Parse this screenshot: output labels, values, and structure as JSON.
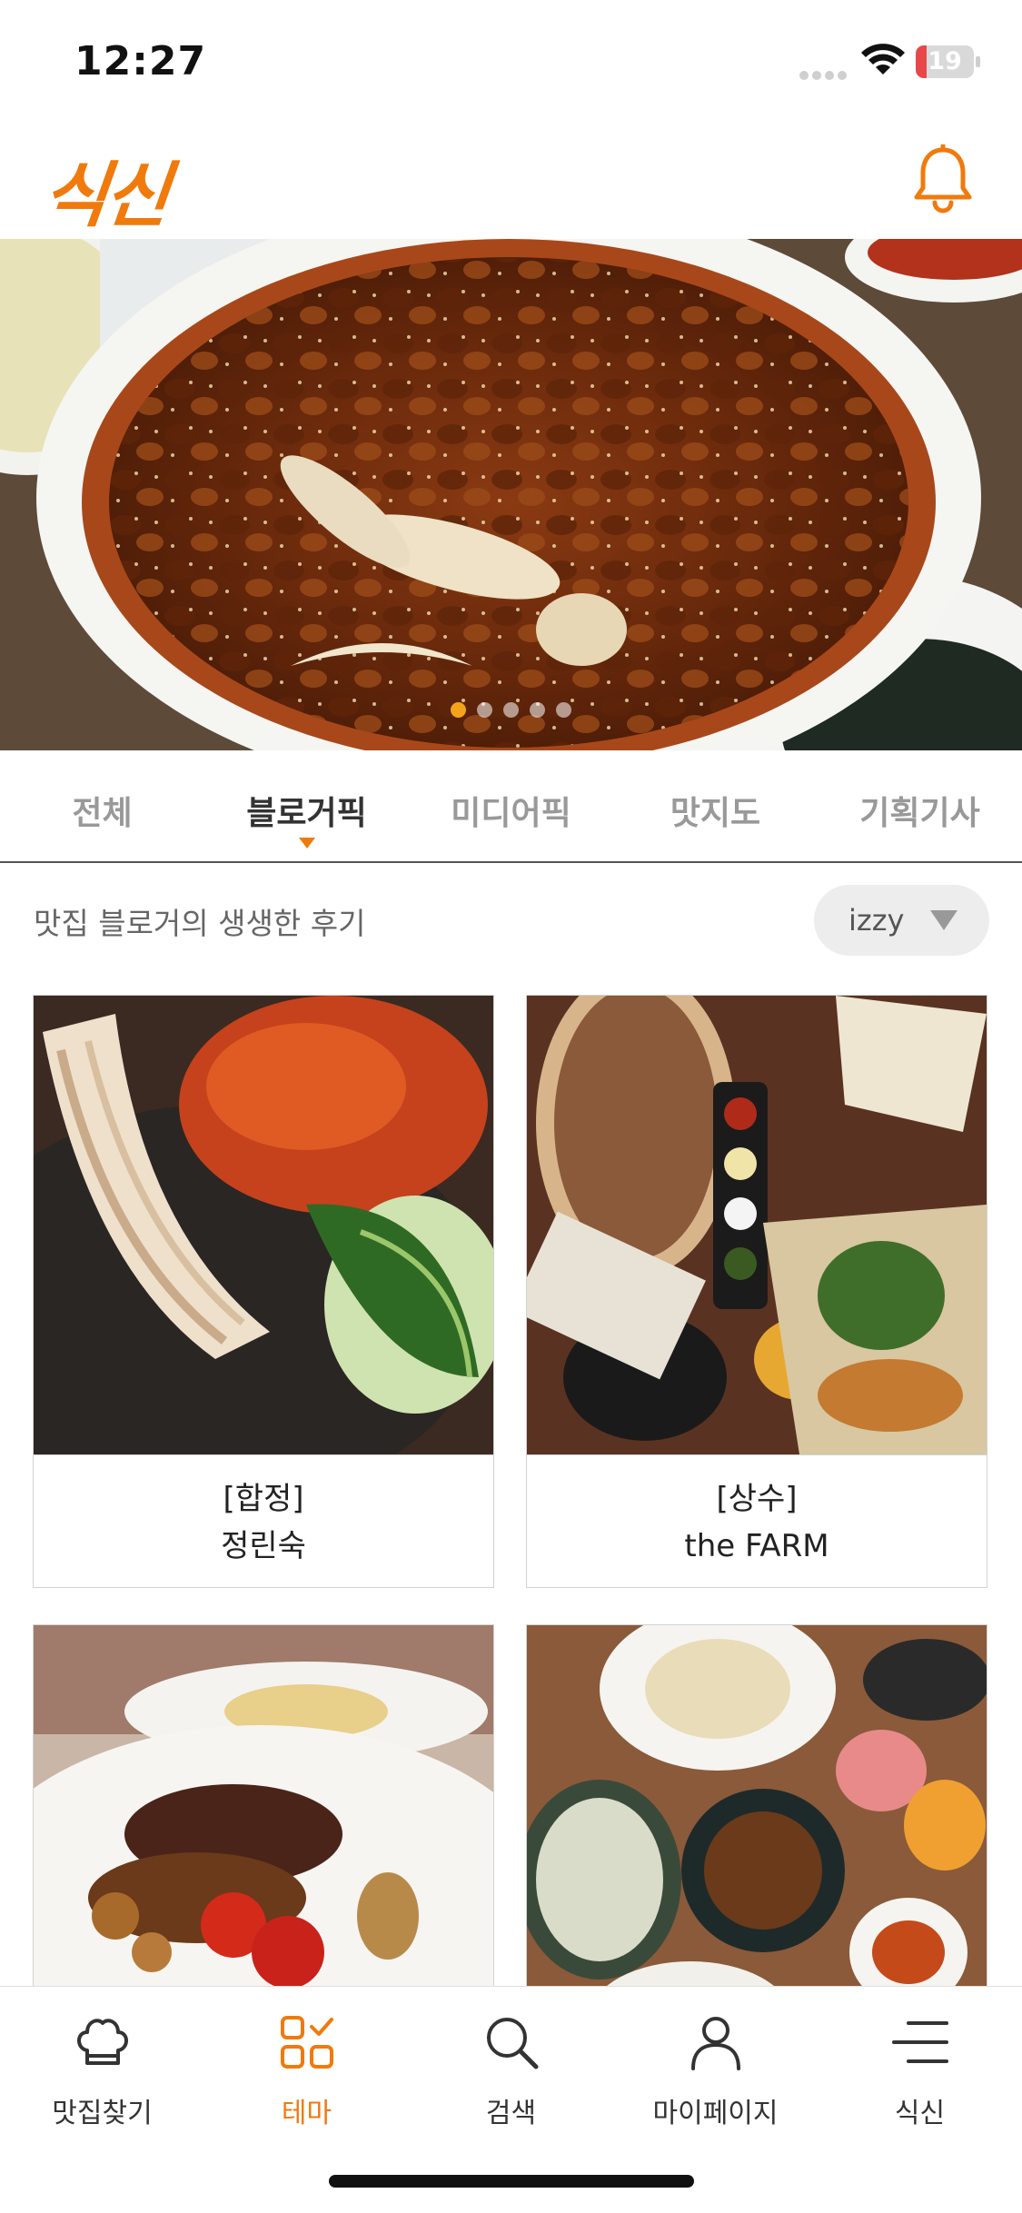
{
  "status_bar": {
    "time": "12:27",
    "battery_level": "19",
    "battery_fraction": 0.19
  },
  "header": {
    "logo_text": "식신",
    "brand_color": "#f07a0c"
  },
  "hero": {
    "slide_count": 5,
    "active_slide": 1
  },
  "tabs": [
    {
      "label": "전체",
      "active": false
    },
    {
      "label": "블로거픽",
      "active": true
    },
    {
      "label": "미디어픽",
      "active": false
    },
    {
      "label": "맛지도",
      "active": false
    },
    {
      "label": "기획기사",
      "active": false
    }
  ],
  "subheader": {
    "title": "맛집 블로거의 생생한 후기",
    "sort_value": "izzy"
  },
  "cards": [
    {
      "region": "[합정]",
      "name": "정린숙"
    },
    {
      "region": "[상수]",
      "name": "the FARM"
    },
    {
      "region": "",
      "name": ""
    },
    {
      "region": "",
      "name": ""
    }
  ],
  "bottom_nav": [
    {
      "label": "맛집찾기",
      "icon": "chef-hat-icon",
      "active": false
    },
    {
      "label": "테마",
      "icon": "theme-grid-icon",
      "active": true
    },
    {
      "label": "검색",
      "icon": "search-icon",
      "active": false
    },
    {
      "label": "마이페이지",
      "icon": "person-icon",
      "active": false
    },
    {
      "label": "식신",
      "icon": "menu-icon",
      "active": false
    }
  ]
}
